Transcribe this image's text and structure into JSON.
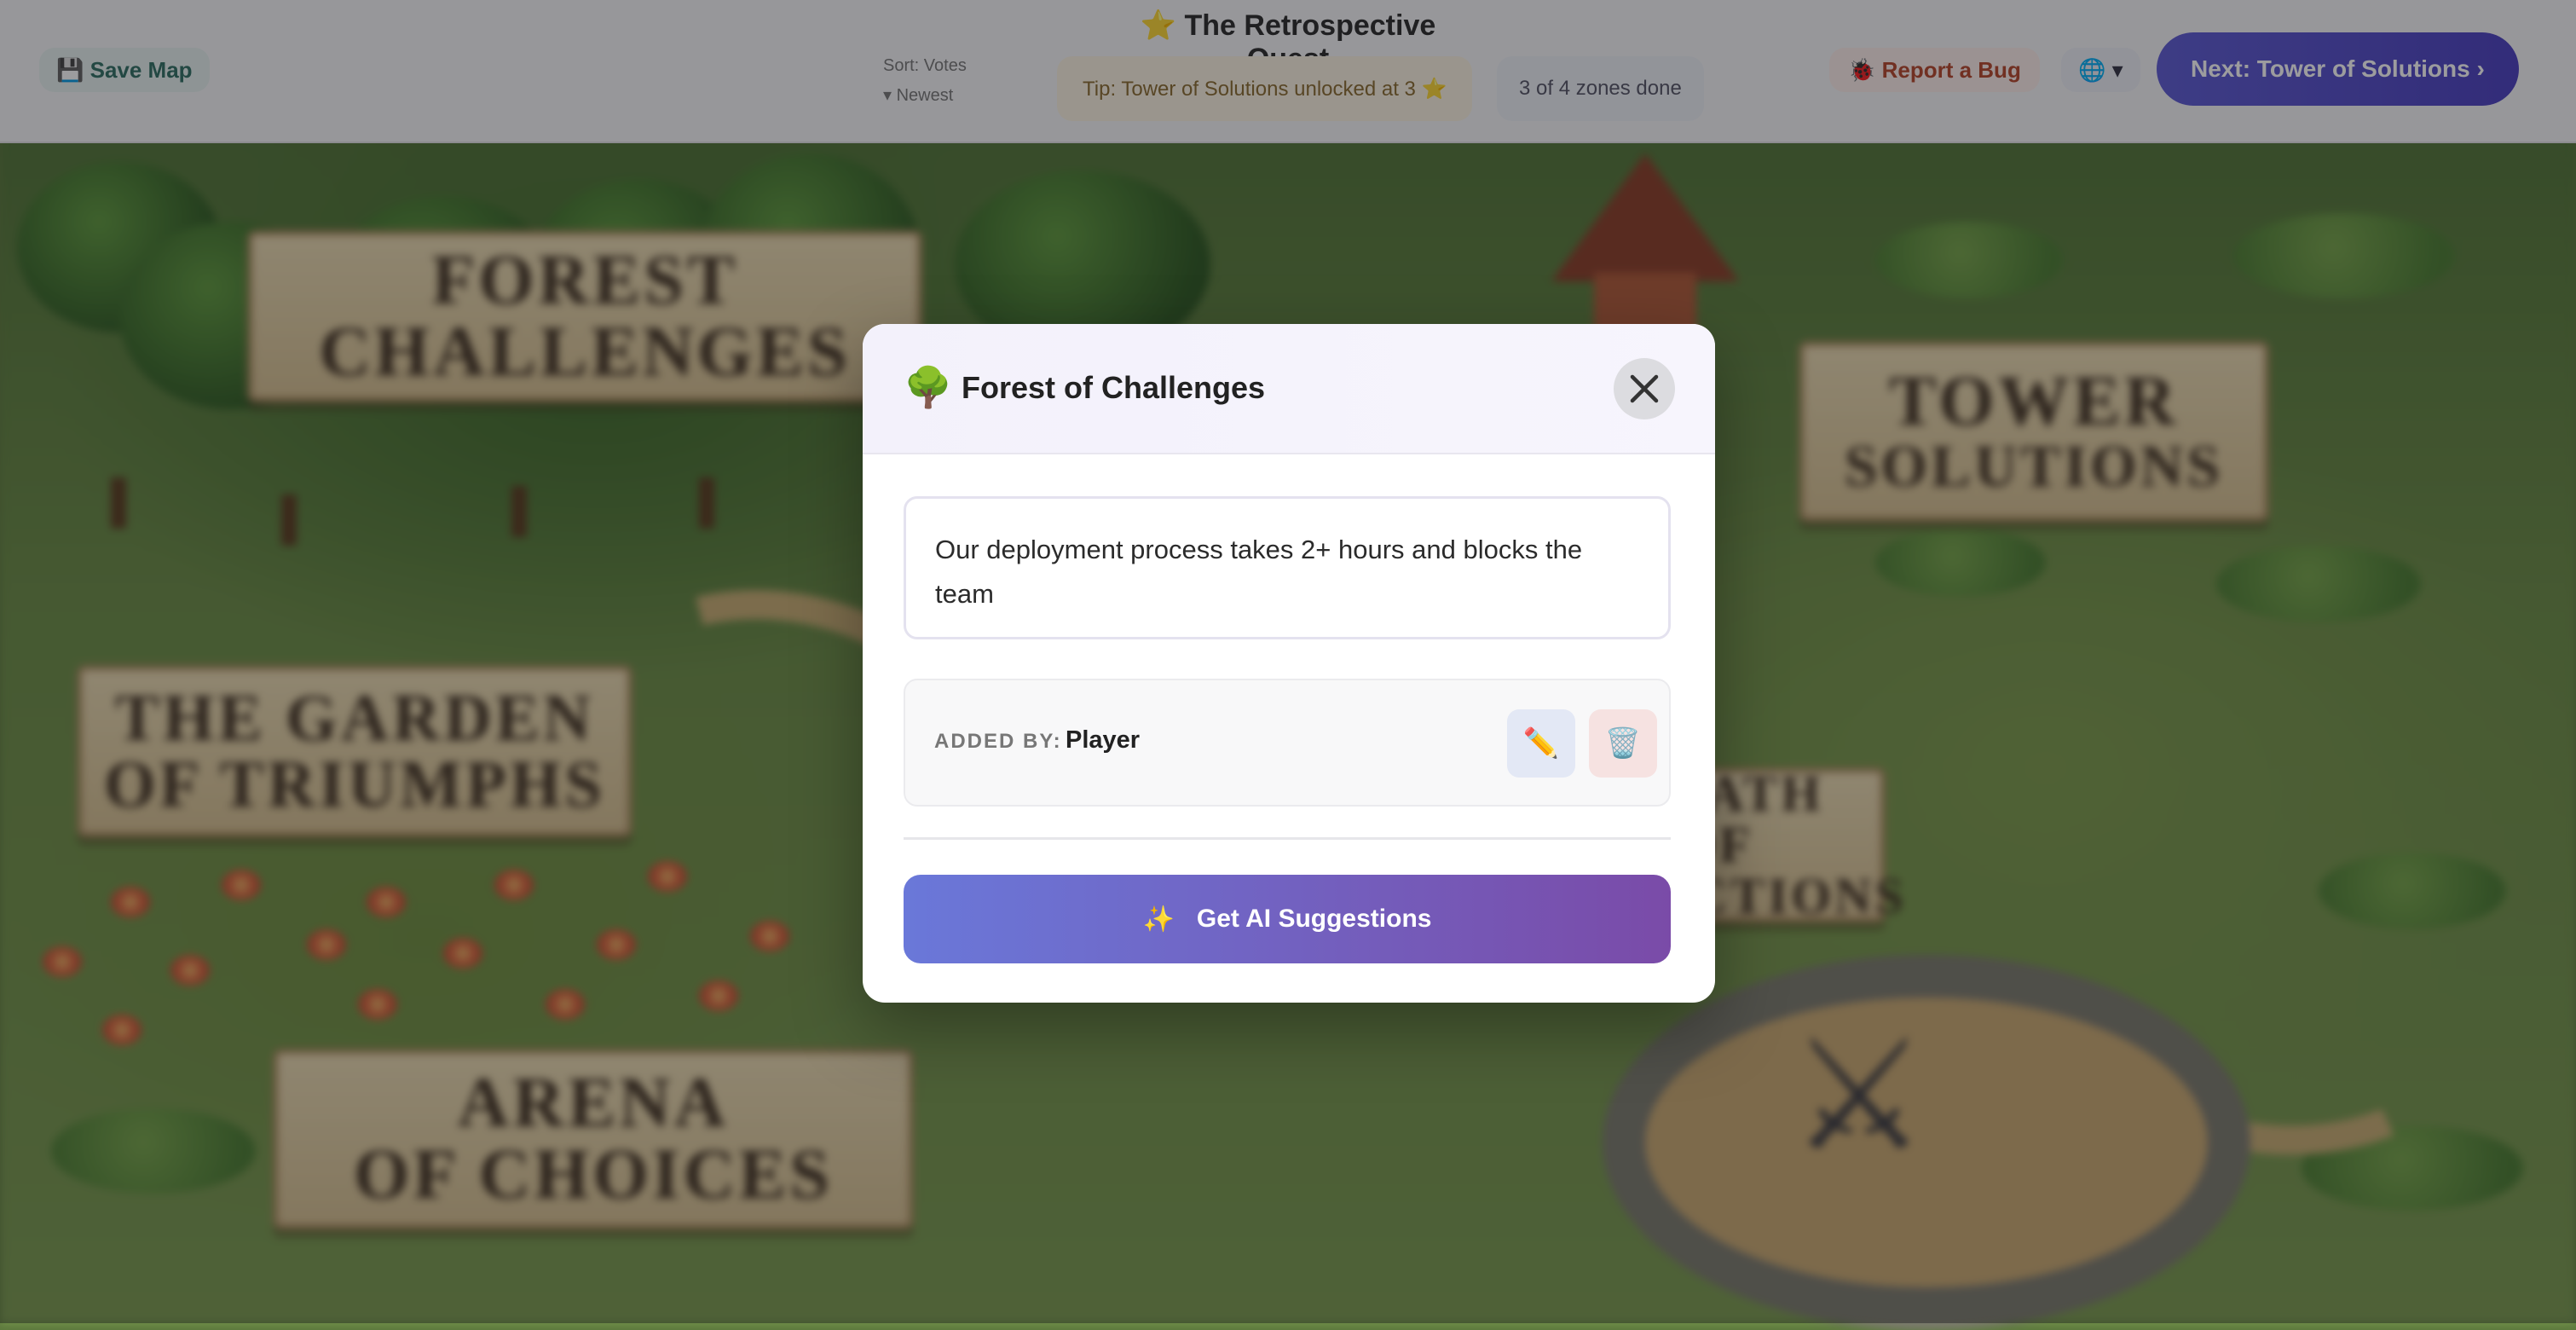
{
  "header": {
    "game_title": "⭐ The Retrospective Quest",
    "save_map_label": "💾 Save Map",
    "sort_top": "Sort: Votes",
    "sort_bottom": "▾ Newest",
    "tip_text": "Tip: Tower of Solutions unlocked at 3 ⭐",
    "progress_text": "3 of 4 zones done",
    "report_bug_label": "🐞 Report a Bug",
    "lang_label": "🌐 ▾",
    "cta_label": "Next: Tower of Solutions ›"
  },
  "map": {
    "signs": [
      {
        "line1": "Forest",
        "line2": "Challenges"
      },
      {
        "line1": "The Garden",
        "line2": "of Triumphs"
      },
      {
        "line1": "Arena",
        "line2": "of Choices"
      },
      {
        "line1": "Tower",
        "line2": "Solutions"
      },
      {
        "line1": "Path of",
        "line2": "Actions"
      }
    ]
  },
  "modal": {
    "icon": "🌳",
    "icon_name": "tree-icon",
    "title": "Forest of Challenges",
    "close_icon": "close-icon",
    "description": "Our deployment process takes 2+ hours and blocks the team",
    "added_by_label": "ADDED BY:",
    "added_by_value": "Player",
    "edit_icon": "✏️",
    "delete_icon": "🗑️",
    "ai_button": {
      "icon": "✨",
      "label": "Get AI Suggestions"
    }
  },
  "colors": {
    "accent_gradient_start": "#6a78d9",
    "accent_gradient_end": "#7a4ba8",
    "overlay": "rgba(20,20,24,0.42)"
  }
}
